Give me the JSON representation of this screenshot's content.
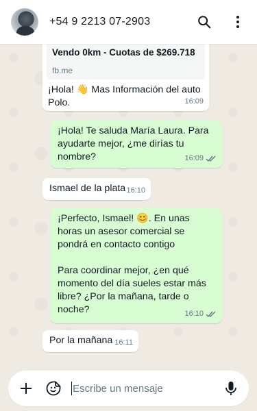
{
  "header": {
    "contact_name": "+54 9 2213 07-2903",
    "icons": [
      "avatar",
      "search-icon",
      "more-vertical-icon"
    ]
  },
  "messages": [
    {
      "direction": "in",
      "link_preview": {
        "title": "Vendo 0km - Cuotas de $269.718",
        "domain": "fb.me"
      },
      "text": "¡Hola! 👋 Mas Información del auto Polo.",
      "time": "16:09"
    },
    {
      "direction": "out",
      "text": "¡Hola! Te saluda María Laura. Para ayudarte mejor, ¿me dirías tu nombre?",
      "time": "16:09",
      "status": "read"
    },
    {
      "direction": "in",
      "text": "Ismael de la plata",
      "time": "16:10"
    },
    {
      "direction": "out",
      "text": "¡Perfecto, Ismael! 😊. En unas horas un asesor comercial se pondrá en contacto contigo\n\nPara coordinar mejor, ¿en qué momento del día sueles estar más libre? ¿Por la mañana, tarde o noche?",
      "time": "16:10",
      "status": "read"
    },
    {
      "direction": "in",
      "text": "Por la mañana",
      "time": "16:11"
    }
  ],
  "composer": {
    "placeholder": "Escribe un mensaje",
    "value": "",
    "icons": [
      "plus-icon",
      "sticker-icon",
      "mic-icon"
    ]
  },
  "colors": {
    "chat_background": "#efeae2",
    "incoming_bubble": "#ffffff",
    "outgoing_bubble": "#d9fdd3",
    "read_ticks": "#667781",
    "meta_text": "#667781"
  }
}
